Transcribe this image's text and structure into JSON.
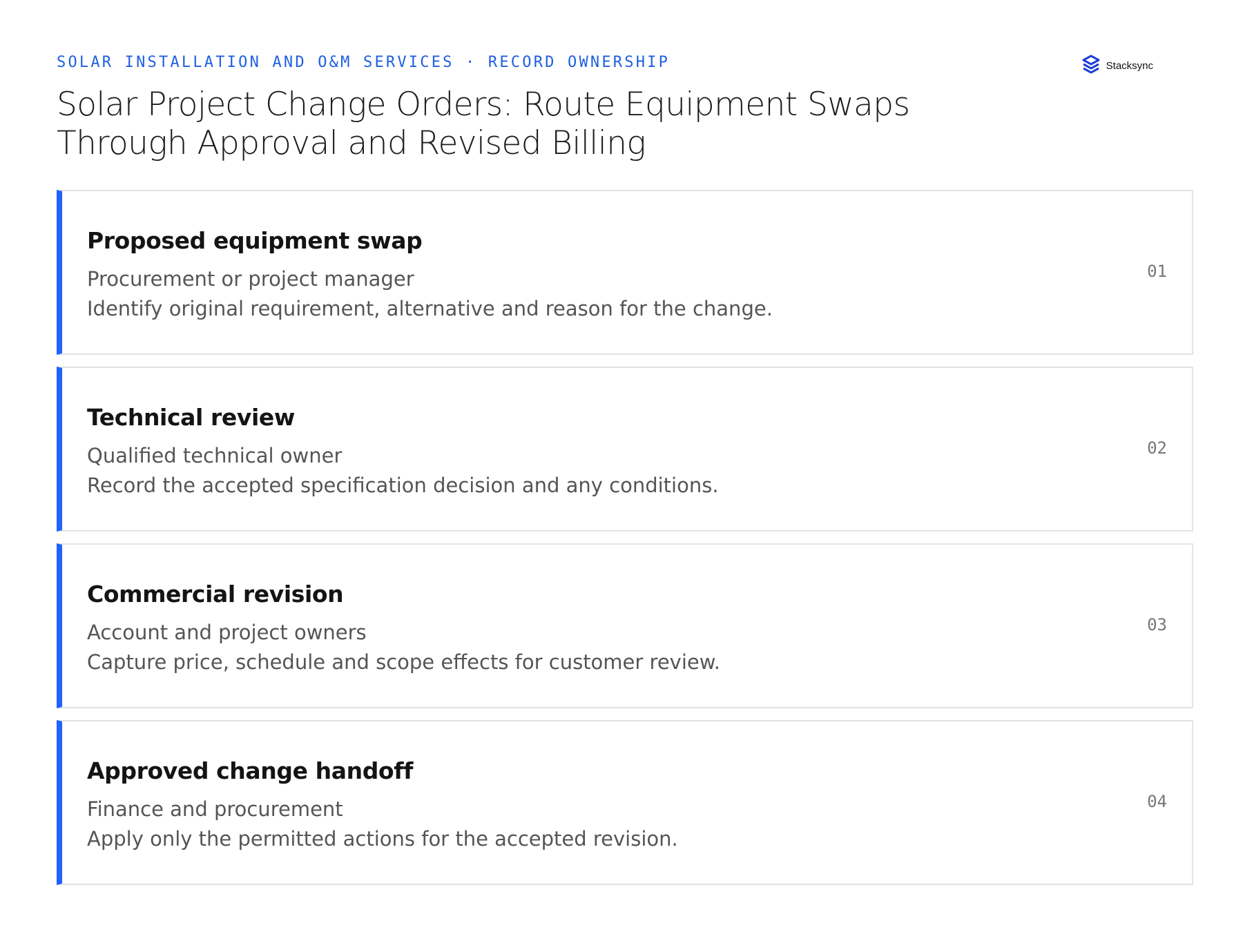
{
  "header": {
    "eyebrow": "SOLAR INSTALLATION AND O&M SERVICES · RECORD OWNERSHIP",
    "title": "Solar Project Change Orders: Route Equipment Swaps Through Approval and Revised Billing"
  },
  "brand": {
    "name": "Stacksync",
    "icon": "stacksync-logo-icon",
    "color": "#1f3fd6"
  },
  "colors": {
    "accent": "#1f62ff",
    "eyebrow": "#1f5fe0"
  },
  "steps": [
    {
      "number": "01",
      "title": "Proposed equipment swap",
      "owner": "Procurement or project manager",
      "description": "Identify original requirement, alternative and reason for the change."
    },
    {
      "number": "02",
      "title": "Technical review",
      "owner": "Qualified technical owner",
      "description": "Record the accepted specification decision and any conditions."
    },
    {
      "number": "03",
      "title": "Commercial revision",
      "owner": "Account and project owners",
      "description": "Capture price, schedule and scope effects for customer review."
    },
    {
      "number": "04",
      "title": "Approved change handoff",
      "owner": "Finance and procurement",
      "description": "Apply only the permitted actions for the accepted revision."
    }
  ]
}
